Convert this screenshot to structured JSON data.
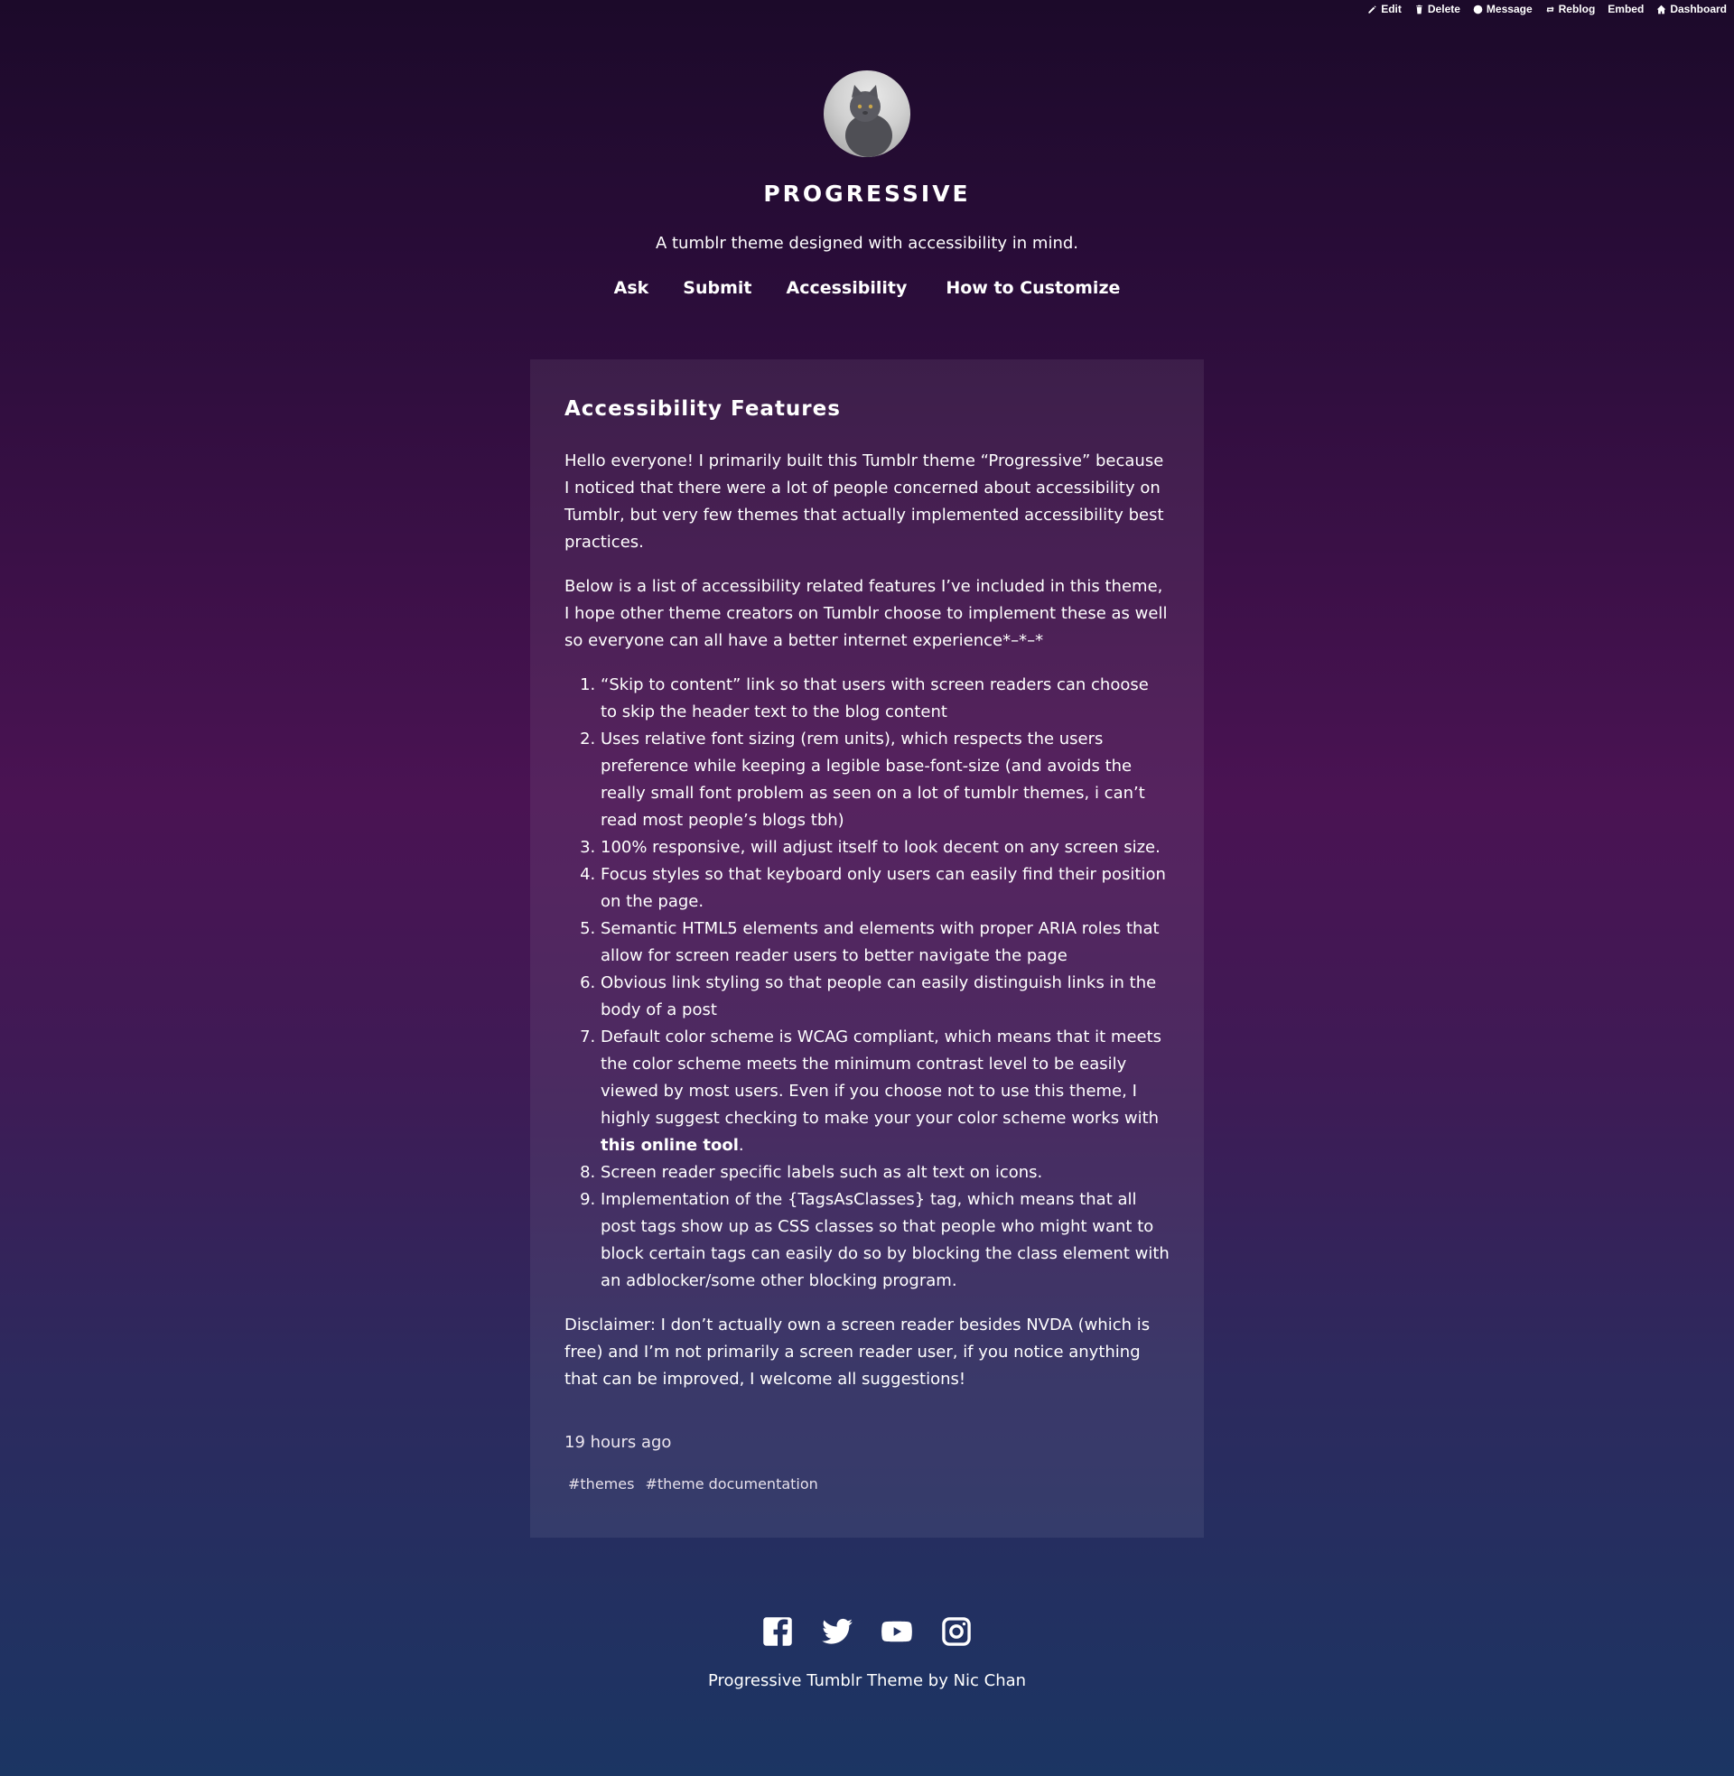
{
  "controls": {
    "edit": "Edit",
    "delete": "Delete",
    "message": "Message",
    "reblog": "Reblog",
    "embed": "Embed",
    "dashboard": "Dashboard"
  },
  "header": {
    "title": "PROGRESSIVE",
    "description": "A tumblr theme designed with accessibility in mind.",
    "nav": [
      "Ask",
      "Submit",
      "Accessibility",
      "How to Customize"
    ]
  },
  "post": {
    "title": "Accessibility Features",
    "intro": "Hello everyone! I primarily built this Tumblr theme “Progressive” because I noticed that there were a lot of people concerned about accessibility on Tumblr, but very few themes that actually implemented accessibility best practices.",
    "list_intro": "Below is a list of accessibility related features I’ve included in this theme, I hope other theme creators on Tumblr choose to implement these as well so everyone can all have a better internet experience*–*–*",
    "items": [
      "“Skip to content” link so that users with screen readers can choose to skip the header text to the blog content",
      "Uses relative font sizing (rem units), which respects the users preference while keeping a legible base-font-size (and avoids the really small font problem as seen on a lot of tumblr themes, i can’t read most people’s blogs tbh)",
      "100% responsive, will adjust itself to look decent on any screen size.",
      "Focus styles so that keyboard only users can easily find their position on the page.",
      "Semantic HTML5 elements and elements with proper ARIA roles that allow for screen reader users to better navigate the page",
      "Obvious link styling so that people can easily distinguish links in the body of a post",
      "Default color scheme is WCAG compliant, which means that it meets the color scheme meets the  minimum contrast level to be easily viewed by most users. Even if you choose not to use this theme, I highly suggest checking to make your your color scheme works with",
      "Screen reader specific labels such as alt text on icons.",
      "Implementation of the {TagsAsClasses} tag, which means that all post tags show up as CSS classes so that people who might want to block certain tags can easily do so by blocking the class element with an adblocker/some other blocking program."
    ],
    "online_tool_link": "this online tool",
    "online_tool_suffix": ".",
    "disclaimer": "Disclaimer: I don’t actually own a screen reader besides NVDA (which is free) and I’m not primarily a screen reader user, if you notice anything that can be improved, I welcome all suggestions!",
    "timestamp": "19 hours ago",
    "tags": [
      "#themes",
      "#theme documentation"
    ]
  },
  "footer": {
    "social_icons": [
      "facebook-icon",
      "twitter-icon",
      "youtube-icon",
      "instagram-icon"
    ],
    "credit": "Progressive Tumblr Theme by Nic Chan"
  },
  "colors": {
    "background_top": "#1c0a2a",
    "background_mid": "#4a1353",
    "background_bottom": "#1b3563",
    "text": "#ffffff"
  }
}
